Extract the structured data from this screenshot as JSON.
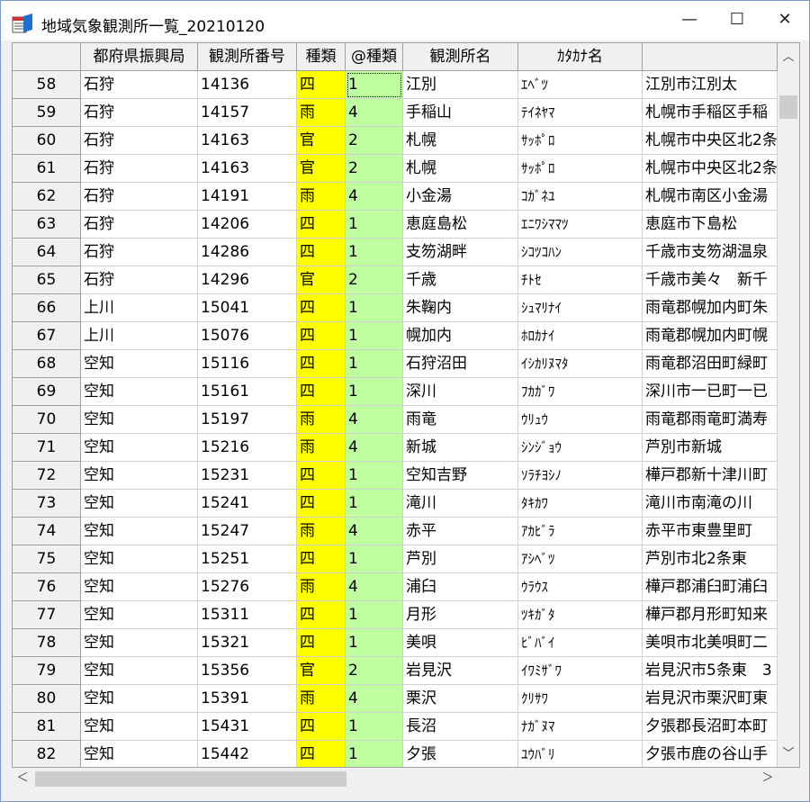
{
  "window": {
    "title": "地域気象観測所一覧_20210120",
    "icon": "table-app-icon",
    "controls": {
      "minimize": "—",
      "maximize": "☐",
      "close": "✕"
    }
  },
  "colors": {
    "kind_column": "#ffff00",
    "at_kind_column": "#c0ffa0"
  },
  "grid": {
    "columns": [
      "",
      "都府県振興局",
      "観測所番号",
      "種類",
      "@種類",
      "観測所名",
      "ｶﾀｶﾅ名",
      ""
    ],
    "rows": [
      [
        "58",
        "石狩",
        "14136",
        "四",
        "1",
        "江別",
        "ｴﾍﾞﾂ",
        "江別市江別太"
      ],
      [
        "59",
        "石狩",
        "14157",
        "雨",
        "4",
        "手稲山",
        "ﾃｲﾈﾔﾏ",
        "札幌市手稲区手稲"
      ],
      [
        "60",
        "石狩",
        "14163",
        "官",
        "2",
        "札幌",
        "ｻｯﾎﾟﾛ",
        "札幌市中央区北2条"
      ],
      [
        "61",
        "石狩",
        "14163",
        "官",
        "2",
        "札幌",
        "ｻｯﾎﾟﾛ",
        "札幌市中央区北2条"
      ],
      [
        "62",
        "石狩",
        "14191",
        "雨",
        "4",
        "小金湯",
        "ｺｶﾞﾈﾕ",
        "札幌市南区小金湯"
      ],
      [
        "63",
        "石狩",
        "14206",
        "四",
        "1",
        "恵庭島松",
        "ｴﾆﾜｼﾏﾏﾂ",
        "恵庭市下島松"
      ],
      [
        "64",
        "石狩",
        "14286",
        "四",
        "1",
        "支笏湖畔",
        "ｼｺﾂｺﾊﾝ",
        "千歳市支笏湖温泉"
      ],
      [
        "65",
        "石狩",
        "14296",
        "官",
        "2",
        "千歳",
        "ﾁﾄｾ",
        "千歳市美々　新千"
      ],
      [
        "66",
        "上川",
        "15041",
        "四",
        "1",
        "朱鞠内",
        "ｼｭﾏﾘﾅｲ",
        "雨竜郡幌加内町朱"
      ],
      [
        "67",
        "上川",
        "15076",
        "四",
        "1",
        "幌加内",
        "ﾎﾛｶﾅｲ",
        "雨竜郡幌加内町幌"
      ],
      [
        "68",
        "空知",
        "15116",
        "四",
        "1",
        "石狩沼田",
        "ｲｼｶﾘﾇﾏﾀ",
        "雨竜郡沼田町緑町"
      ],
      [
        "69",
        "空知",
        "15161",
        "四",
        "1",
        "深川",
        "ﾌｶｶﾞﾜ",
        "深川市一已町一已"
      ],
      [
        "70",
        "空知",
        "15197",
        "雨",
        "4",
        "雨竜",
        "ｳﾘｭｳ",
        "雨竜郡雨竜町満寿"
      ],
      [
        "71",
        "空知",
        "15216",
        "雨",
        "4",
        "新城",
        "ｼﾝｼﾞｮｳ",
        "芦別市新城"
      ],
      [
        "72",
        "空知",
        "15231",
        "四",
        "1",
        "空知吉野",
        "ｿﾗﾁﾖｼﾉ",
        "樺戸郡新十津川町"
      ],
      [
        "73",
        "空知",
        "15241",
        "四",
        "1",
        "滝川",
        "ﾀｷｶﾜ",
        "滝川市南滝の川"
      ],
      [
        "74",
        "空知",
        "15247",
        "雨",
        "4",
        "赤平",
        "ｱｶﾋﾞﾗ",
        "赤平市東豊里町"
      ],
      [
        "75",
        "空知",
        "15251",
        "四",
        "1",
        "芦別",
        "ｱｼﾍﾞﾂ",
        "芦別市北2条東"
      ],
      [
        "76",
        "空知",
        "15276",
        "雨",
        "4",
        "浦臼",
        "ｳﾗｳｽ",
        "樺戸郡浦臼町浦臼"
      ],
      [
        "77",
        "空知",
        "15311",
        "四",
        "1",
        "月形",
        "ﾂｷｶﾞﾀ",
        "樺戸郡月形町知来"
      ],
      [
        "78",
        "空知",
        "15321",
        "四",
        "1",
        "美唄",
        "ﾋﾞﾊﾞｲ",
        "美唄市北美唄町二"
      ],
      [
        "79",
        "空知",
        "15356",
        "官",
        "2",
        "岩見沢",
        "ｲﾜﾐｻﾞﾜ",
        "岩見沢市5条東　3"
      ],
      [
        "80",
        "空知",
        "15391",
        "雨",
        "4",
        "栗沢",
        "ｸﾘｻﾜ",
        "岩見沢市栗沢町東"
      ],
      [
        "81",
        "空知",
        "15431",
        "四",
        "1",
        "長沼",
        "ﾅｶﾞﾇﾏ",
        "夕張郡長沼町本町"
      ],
      [
        "82",
        "空知",
        "15442",
        "四",
        "1",
        "夕張",
        "ﾕｳﾊﾞﾘ",
        "夕張市鹿の谷山手"
      ]
    ]
  },
  "scrollbars": {
    "up": "︿",
    "down": "﹀",
    "left": "＜",
    "right": "＞"
  }
}
